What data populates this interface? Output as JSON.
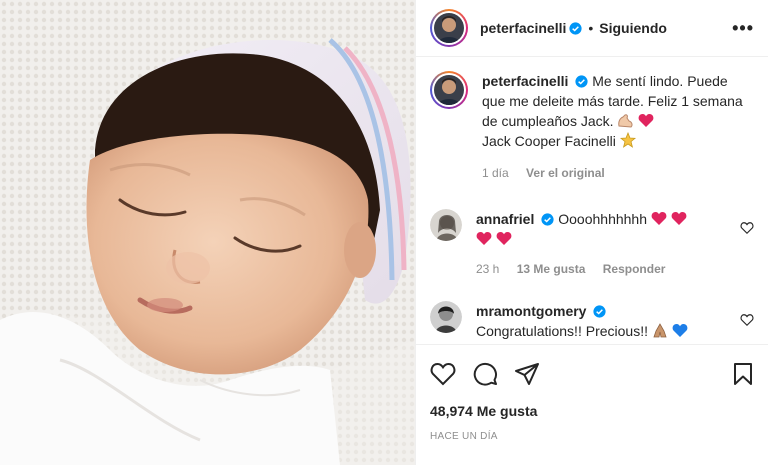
{
  "header": {
    "username": "peterfacinelli",
    "separator": "•",
    "follow_label": "Siguiendo",
    "more_label": "•••"
  },
  "caption": {
    "username": "peterfacinelli",
    "text": "Me sentí lindo. Puede que me deleite más tarde. Feliz 1 semana de cumpleaños Jack.",
    "text2": "Jack Cooper Facinelli",
    "time": "1 día",
    "see_original": "Ver el original"
  },
  "comments": [
    {
      "username": "annafriel",
      "text": "Oooohhhhhhh",
      "time": "23 h",
      "likes": "13 Me gusta",
      "reply": "Responder"
    },
    {
      "username": "mramontgomery",
      "text": "Congratulations!! Precious!!"
    }
  ],
  "stats": {
    "likes": "48,974 Me gusta",
    "date": "HACE UN DÍA"
  },
  "colors": {
    "verified": "#0095f6",
    "heart": "#e0245e",
    "text_secondary": "#8e8e8e"
  }
}
